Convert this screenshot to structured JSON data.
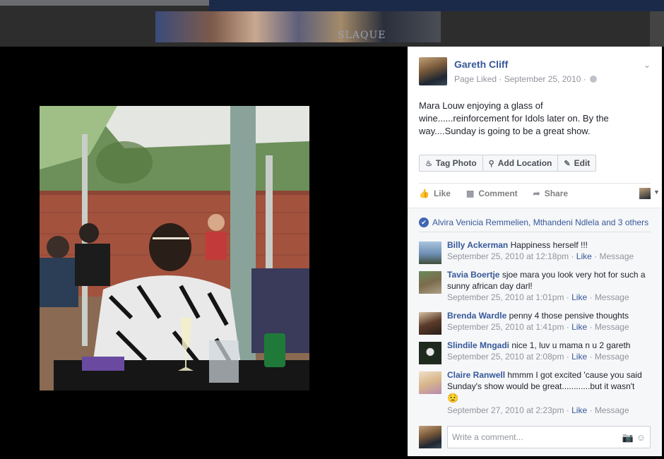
{
  "cover": {
    "text": "SLAQUE"
  },
  "post": {
    "author": "Gareth Cliff",
    "meta": "Page Liked · September 25, 2010 ·",
    "caption": "Mara Louw enjoying a glass of wine......reinforcement for Idols later on. By the way....Sunday is going to be a great show.",
    "tag_actions": [
      {
        "label": "Tag Photo",
        "icon": "tag-icon"
      },
      {
        "label": "Add Location",
        "icon": "pin-icon"
      },
      {
        "label": "Edit",
        "icon": "pencil-icon"
      }
    ],
    "actions": [
      {
        "label": "Like",
        "icon": "thumbs-up-icon"
      },
      {
        "label": "Comment",
        "icon": "comment-icon"
      },
      {
        "label": "Share",
        "icon": "share-icon"
      }
    ],
    "likes_summary": "Alvira Venicia Remmelien, Mthandeni Ndlela and 3 others"
  },
  "comments": [
    {
      "name": "Billy Ackerman",
      "text": "Happiness herself !!!",
      "time": "September 25, 2010 at 12:18pm ·",
      "like": "Like",
      "message": "Message",
      "avatar_color": "#6e8fb4"
    },
    {
      "name": "Tavia Boertje",
      "text": "sjoe mara you look very hot for such a sunny african day darl!",
      "time": "September 25, 2010 at 1:01pm ·",
      "like": "Like",
      "message": "Message",
      "avatar_color": "#7a6b4c"
    },
    {
      "name": "Brenda Wardle",
      "text": "penny 4 those pensive thoughts",
      "time": "September 25, 2010 at 1:41pm ·",
      "like": "Like",
      "message": "Message",
      "avatar_color": "#5a3a2a"
    },
    {
      "name": "Slindile Mngadi",
      "text": "nice 1, luv u mama n u 2 gareth",
      "time": "September 25, 2010 at 2:08pm ·",
      "like": "Like",
      "message": "Message",
      "avatar_color": "#1f2a1f"
    },
    {
      "name": "Claire Ranwell",
      "text": "hmmm I got excited 'cause you said Sunday's show would be great............but it wasn't",
      "emoji": "😟",
      "time": "September 27, 2010 at 2:23pm ·",
      "like": "Like",
      "message": "Message",
      "avatar_color": "#d8b58a"
    }
  ],
  "reply": {
    "placeholder": "Write a comment..."
  }
}
